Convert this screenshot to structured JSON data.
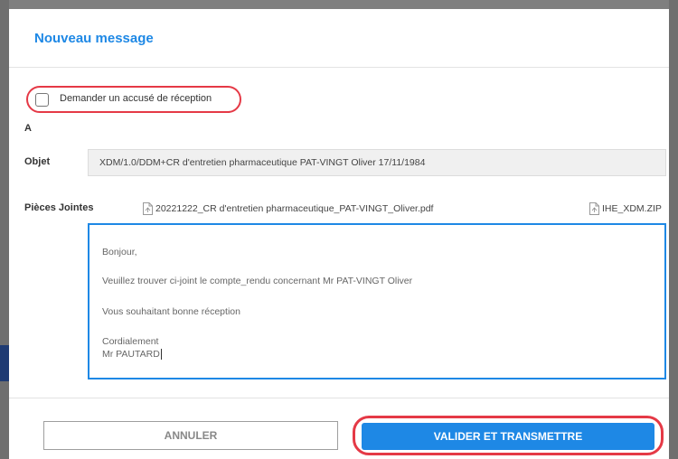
{
  "dialog": {
    "title": "Nouveau message"
  },
  "receipt": {
    "label": "Demander un accusé de réception",
    "checked": false
  },
  "fields": {
    "to_label": "A",
    "subject_label": "Objet",
    "subject_value": "XDM/1.0/DDM+CR d'entretien pharmaceutique PAT-VINGT Oliver 17/11/1984",
    "attachments_label": "Pièces Jointes"
  },
  "attachments": [
    {
      "name": "20221222_CR d'entretien pharmaceutique_PAT-VINGT_Oliver.pdf",
      "icon": "file-icon"
    },
    {
      "name": "IHE_XDM.ZIP",
      "icon": "file-icon"
    }
  ],
  "message": {
    "greeting": "Bonjour,",
    "line1": "Veuillez trouver ci-joint le compte_rendu concernant Mr PAT-VINGT Oliver",
    "line2": "Vous souhaitant bonne réception",
    "closing": "Cordialement",
    "signature": "Mr PAUTARD"
  },
  "buttons": {
    "cancel": "ANNULER",
    "validate": "VALIDER ET TRANSMETTRE"
  },
  "colors": {
    "accent": "#1e88e5",
    "highlight": "#e53946"
  }
}
